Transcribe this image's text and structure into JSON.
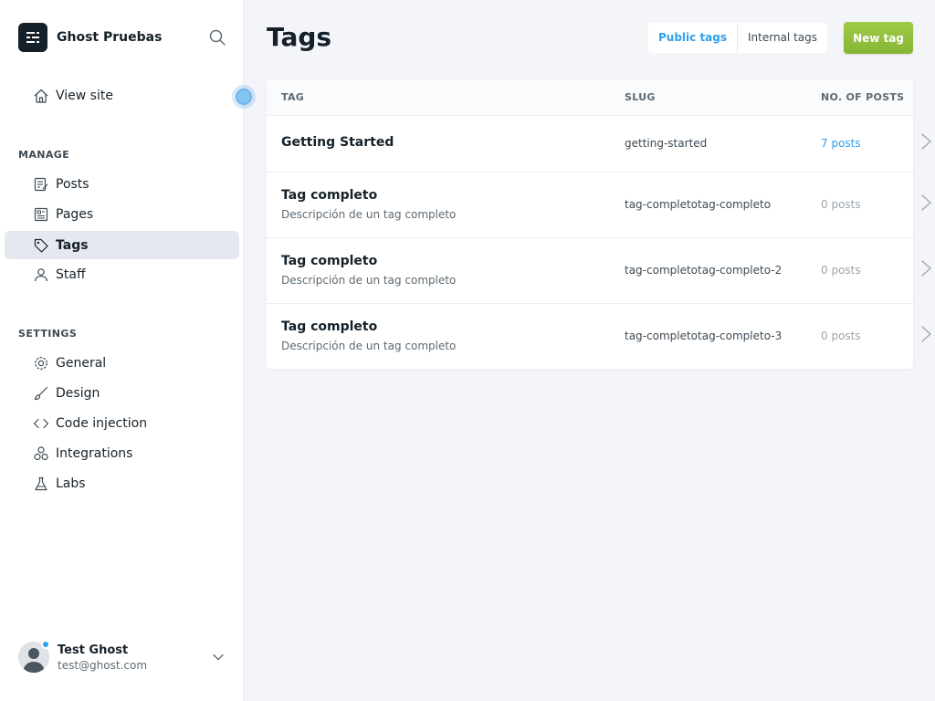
{
  "sidebar": {
    "brand_name": "Ghost Pruebas",
    "view_site": "View site",
    "manage_title": "MANAGE",
    "manage_items": [
      {
        "label": "Posts",
        "icon": "posts-icon"
      },
      {
        "label": "Pages",
        "icon": "pages-icon"
      },
      {
        "label": "Tags",
        "icon": "tag-icon",
        "active": true
      },
      {
        "label": "Staff",
        "icon": "staff-icon"
      }
    ],
    "settings_title": "SETTINGS",
    "settings_items": [
      {
        "label": "General",
        "icon": "gear-icon"
      },
      {
        "label": "Design",
        "icon": "brush-icon"
      },
      {
        "label": "Code injection",
        "icon": "code-icon"
      },
      {
        "label": "Integrations",
        "icon": "integrations-icon"
      },
      {
        "label": "Labs",
        "icon": "flask-icon"
      }
    ],
    "user": {
      "name": "Test Ghost",
      "email": "test@ghost.com"
    }
  },
  "main": {
    "title": "Tags",
    "tabs": [
      {
        "label": "Public tags",
        "active": true
      },
      {
        "label": "Internal tags",
        "active": false
      }
    ],
    "new_tag_label": "New tag",
    "table": {
      "headers": {
        "tag": "TAG",
        "slug": "SLUG",
        "posts": "NO. OF POSTS"
      },
      "rows": [
        {
          "name": "Getting Started",
          "description": "",
          "slug": "getting-started",
          "count": "7 posts"
        },
        {
          "name": "Tag completo",
          "description": "Descripción de un tag completo",
          "slug": "tag-completotag-completo",
          "count": "0 posts"
        },
        {
          "name": "Tag completo",
          "description": "Descripción de un tag completo",
          "slug": "tag-completotag-completo-2",
          "count": "0 posts"
        },
        {
          "name": "Tag completo",
          "description": "Descripción de un tag completo",
          "slug": "tag-completotag-completo-3",
          "count": "0 posts"
        }
      ]
    }
  },
  "colors": {
    "accent": "#30a0e8",
    "new_tag_button": "#92c03f",
    "active_nav_bg": "#e5e9ef"
  }
}
